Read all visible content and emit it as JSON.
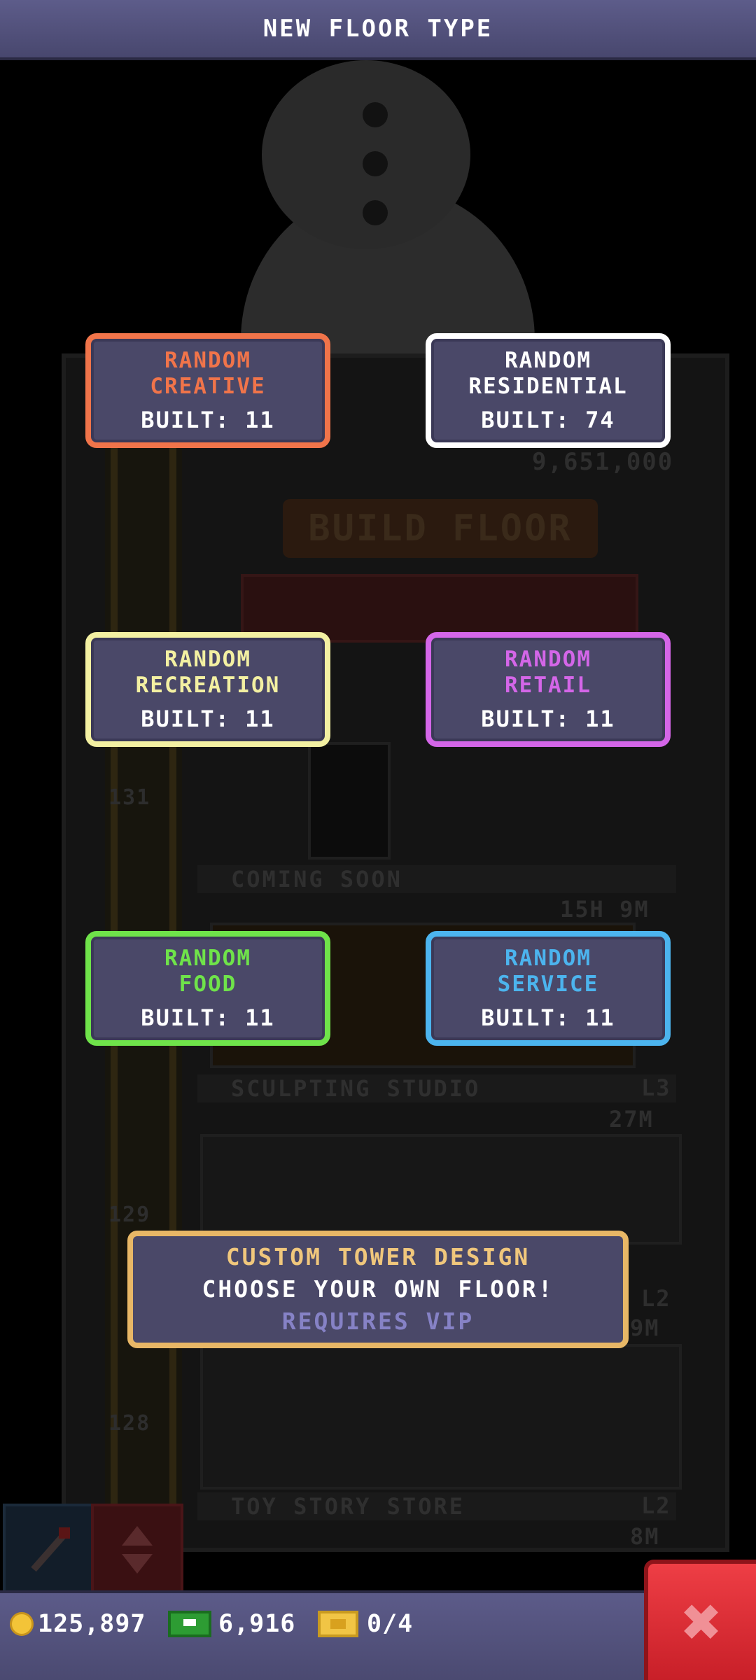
{
  "header": {
    "title": "NEW FLOOR TYPE"
  },
  "floor_types": [
    {
      "name_line1": "RANDOM",
      "name_line2": "CREATIVE",
      "built_label": "BUILT: 11",
      "color": "#f0744a"
    },
    {
      "name_line1": "RANDOM",
      "name_line2": "RESIDENTIAL",
      "built_label": "BUILT: 74",
      "color": "#ffffff"
    },
    {
      "name_line1": "RANDOM",
      "name_line2": "RECREATION",
      "built_label": "BUILT: 11",
      "color": "#f3f0a2"
    },
    {
      "name_line1": "RANDOM",
      "name_line2": "RETAIL",
      "built_label": "BUILT: 11",
      "color": "#d466e8"
    },
    {
      "name_line1": "RANDOM",
      "name_line2": "FOOD",
      "built_label": "BUILT: 11",
      "color": "#6fe34a"
    },
    {
      "name_line1": "RANDOM",
      "name_line2": "SERVICE",
      "built_label": "BUILT: 11",
      "color": "#4cb4ee"
    }
  ],
  "custom_design": {
    "title": "CUSTOM TOWER DESIGN",
    "subtitle": "CHOOSE YOUR OWN FLOOR!",
    "requirement": "REQUIRES VIP"
  },
  "background": {
    "price": "9,651,000",
    "build_floor": "BUILD FLOOR",
    "coming_soon": "COMING SOON",
    "timer": "15H 9M",
    "sculpting_studio": "SCULPTING STUDIO",
    "level_l3": "L3",
    "amount_27m": "27M",
    "level_l2a": "L2",
    "amount_9m": "9M",
    "toy_story_store": "TOY STORY STORE",
    "level_l2b": "L2",
    "amount_8m": "8M",
    "floor_131": "131",
    "floor_129": "129",
    "floor_128": "128"
  },
  "status": {
    "coins": "125,897",
    "bux": "6,916",
    "tickets": "0/4"
  },
  "icons": {
    "coin": "coin-icon",
    "bux": "tower-bux-icon",
    "ticket": "golden-ticket-icon",
    "close": "close-icon",
    "pick": "pick-icon",
    "elevator": "elevator-arrows-icon"
  }
}
